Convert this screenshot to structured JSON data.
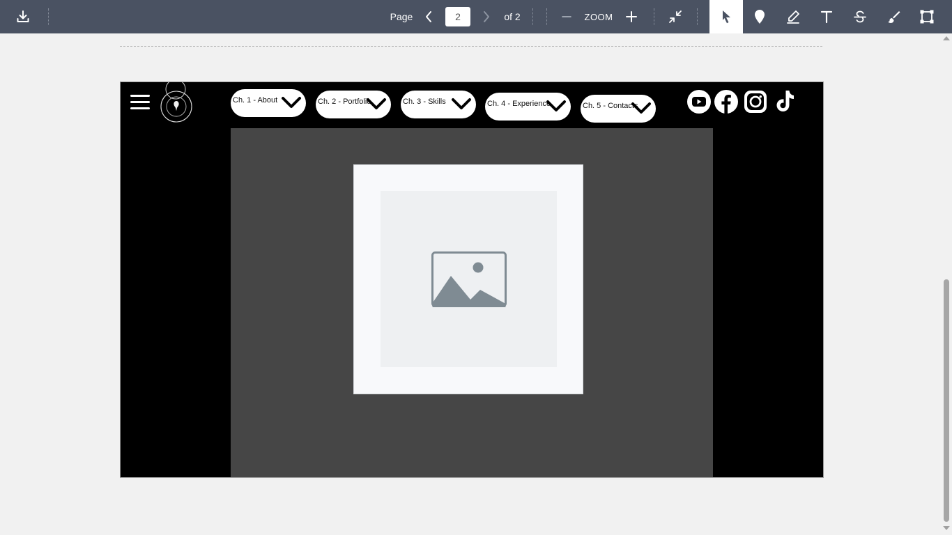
{
  "toolbar": {
    "download_icon": "download-icon",
    "page_label": "Page",
    "page_input_value": "2",
    "of_label": "of 2",
    "zoom_label": "ZOOM",
    "icons": {
      "prev": "chevron-left-icon",
      "next": "chevron-right-icon",
      "zoom_out": "minus-icon",
      "zoom_in": "plus-icon",
      "collapse": "collapse-icon",
      "select": "cursor-icon",
      "pin": "pin-icon",
      "highlight": "pen-icon",
      "text": "text-icon",
      "strikethrough": "strikethrough-icon",
      "draw": "brush-icon",
      "shape": "rectangle-icon"
    },
    "active_tool": "select"
  },
  "document": {
    "current_page": 2,
    "total_pages": 2,
    "nav": [
      {
        "label": "Ch. 1 - About"
      },
      {
        "label": "Ch. 2 - Portfolio"
      },
      {
        "label": "Ch. 3 - Skills"
      },
      {
        "label": "Ch. 4 - Experience"
      },
      {
        "label": "Ch. 5 - Contacts"
      }
    ],
    "social": [
      "youtube-icon",
      "facebook-icon",
      "instagram-icon",
      "tiktok-icon"
    ],
    "image_placeholder": "image-icon"
  },
  "colors": {
    "toolbar_bg": "#4a5262",
    "page_bg": "#000000",
    "content_bg": "#464646",
    "viewer_bg": "#f1f1f1",
    "placeholder_icon": "#7f8b93"
  }
}
